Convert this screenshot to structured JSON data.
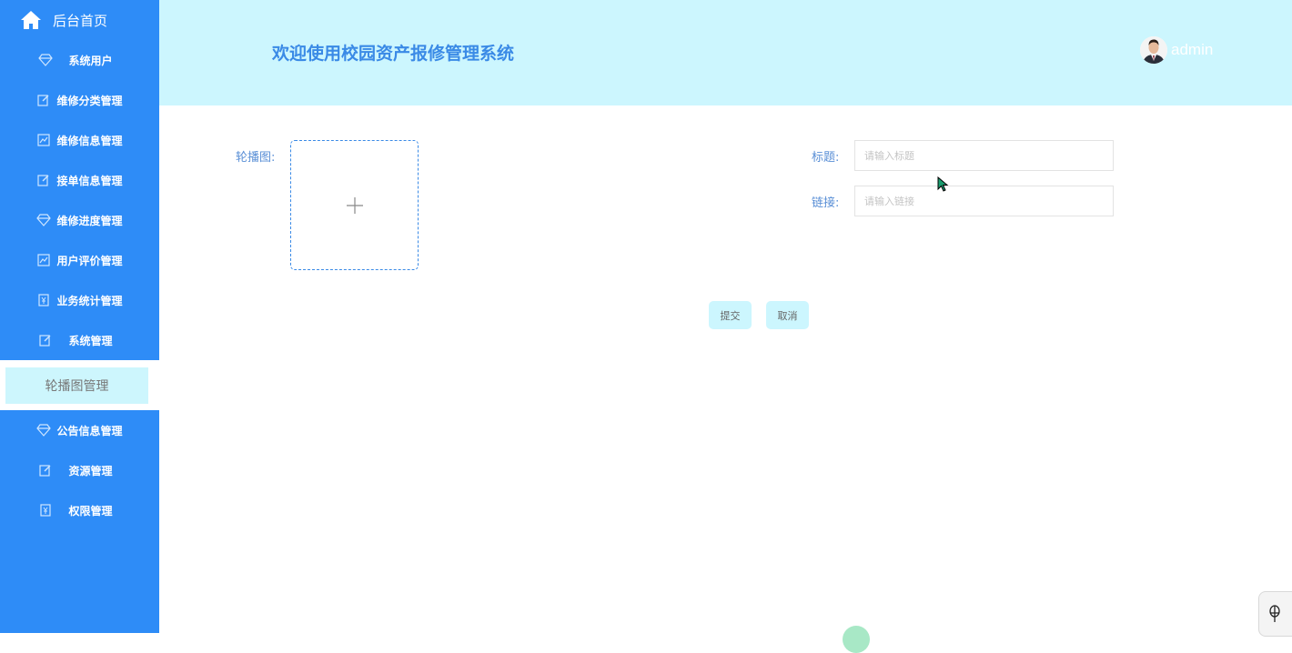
{
  "sidebar": {
    "home_label": "后台首页",
    "items": [
      {
        "label": "系统用户",
        "icon": "diamond-icon"
      },
      {
        "label": "维修分类管理",
        "icon": "edit-icon"
      },
      {
        "label": "维修信息管理",
        "icon": "chart-icon"
      },
      {
        "label": "接单信息管理",
        "icon": "edit-icon"
      },
      {
        "label": "维修进度管理",
        "icon": "diamond-icon"
      },
      {
        "label": "用户评价管理",
        "icon": "chart-icon"
      },
      {
        "label": "业务统计管理",
        "icon": "ticket-icon"
      },
      {
        "label": "系统管理",
        "icon": "edit-icon"
      },
      {
        "label": "轮播图管理",
        "icon": ""
      },
      {
        "label": "公告信息管理",
        "icon": "diamond-icon"
      },
      {
        "label": "资源管理",
        "icon": "edit-icon"
      },
      {
        "label": "权限管理",
        "icon": "ticket-icon"
      }
    ]
  },
  "header": {
    "title": "欢迎使用校园资产报修管理系统",
    "username": "admin"
  },
  "form": {
    "carousel_label": "轮播图:",
    "title_label": "标题:",
    "title_placeholder": "请输入标题",
    "link_label": "链接:",
    "link_placeholder": "请输入链接",
    "submit_label": "提交",
    "cancel_label": "取消"
  },
  "colors": {
    "sidebar_bg": "#2e8cf7",
    "header_bg": "#ccf6fe",
    "accent": "#3a8ae6"
  }
}
